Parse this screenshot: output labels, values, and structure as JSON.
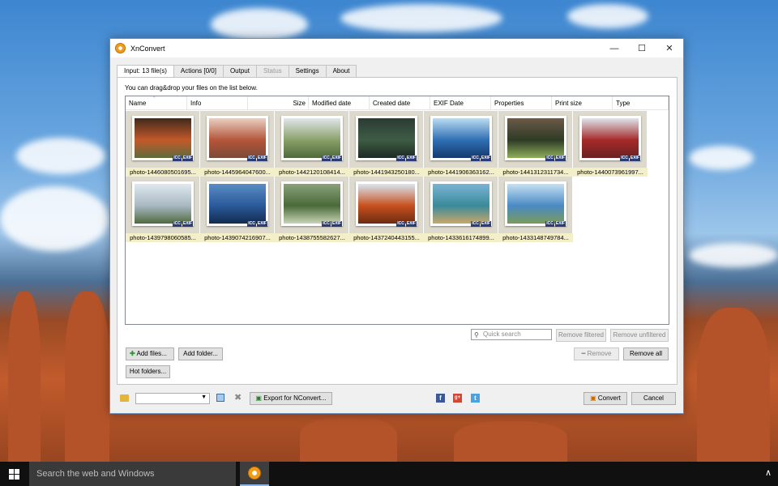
{
  "window": {
    "title": "XnConvert",
    "minimize": "—",
    "maximize": "☐",
    "close": "✕"
  },
  "tabs": [
    {
      "label": "Input: 13 file(s)",
      "state": "active"
    },
    {
      "label": "Actions [0/0]",
      "state": "normal"
    },
    {
      "label": "Output",
      "state": "normal"
    },
    {
      "label": "Status",
      "state": "disabled"
    },
    {
      "label": "Settings",
      "state": "normal"
    },
    {
      "label": "About",
      "state": "normal"
    }
  ],
  "input": {
    "hint": "You can drag&drop your files on the list below.",
    "columns": [
      "Name",
      "Info",
      "Size",
      "Modified date",
      "Created date",
      "EXIF Date",
      "Properties",
      "Print size",
      "Type"
    ],
    "files": [
      {
        "name": "photo-1446080501695...",
        "colors": [
          "#3f2a1c",
          "#c4592a",
          "#5d6b3a"
        ]
      },
      {
        "name": "photo-1445964047600...",
        "colors": [
          "#e8cfc2",
          "#b4563a",
          "#7a4a38"
        ]
      },
      {
        "name": "photo-1442120108414...",
        "colors": [
          "#dfe6ea",
          "#8aa06a",
          "#4f6a3a"
        ]
      },
      {
        "name": "photo-1441943250180...",
        "colors": [
          "#2b3b34",
          "#3e5c44",
          "#1d2a24"
        ]
      },
      {
        "name": "photo-1441906363162...",
        "colors": [
          "#bcdcf2",
          "#2f6fb4",
          "#143a6e"
        ]
      },
      {
        "name": "photo-1441312311734...",
        "colors": [
          "#6b5a48",
          "#2e3b26",
          "#8fae5a"
        ]
      },
      {
        "name": "photo-1440073961997...",
        "colors": [
          "#dde4ea",
          "#a62a2a",
          "#6a1f22"
        ]
      },
      {
        "name": "photo-1439798060585...",
        "colors": [
          "#dfe8ee",
          "#a9b8c2",
          "#4f6a3e"
        ]
      },
      {
        "name": "photo-1439074216907...",
        "colors": [
          "#5a8cc4",
          "#2a5a9a",
          "#122a4e"
        ]
      },
      {
        "name": "photo-1438755582627...",
        "colors": [
          "#8aa07a",
          "#4a6a3a",
          "#c8d4b6"
        ]
      },
      {
        "name": "photo-1437240443155...",
        "colors": [
          "#d8e6f0",
          "#c8501e",
          "#6a2c12"
        ]
      },
      {
        "name": "photo-1433616174899...",
        "colors": [
          "#7ab4d4",
          "#3a8a9a",
          "#c8a86a"
        ]
      },
      {
        "name": "photo-1433148749784...",
        "colors": [
          "#c6e0f2",
          "#4a8ac4",
          "#7a9a5a"
        ]
      }
    ],
    "badges": [
      "ICC",
      "EXIF"
    ],
    "search_placeholder": "Quick search",
    "search_icon": "magnifier-icon",
    "remove_filtered": "Remove filtered",
    "remove_unfiltered": "Remove unfiltered",
    "add_files": "Add files...",
    "add_folder": "Add folder...",
    "remove": "Remove",
    "remove_all": "Remove all",
    "hot_folders": "Hot folders..."
  },
  "bottom": {
    "export": "Export for NConvert...",
    "convert": "Convert",
    "cancel": "Cancel",
    "facebook": "f",
    "googleplus": "g+",
    "twitter": "t"
  },
  "taskbar": {
    "search_text": "Search the web and Windows",
    "tray_chevron": "∧"
  }
}
